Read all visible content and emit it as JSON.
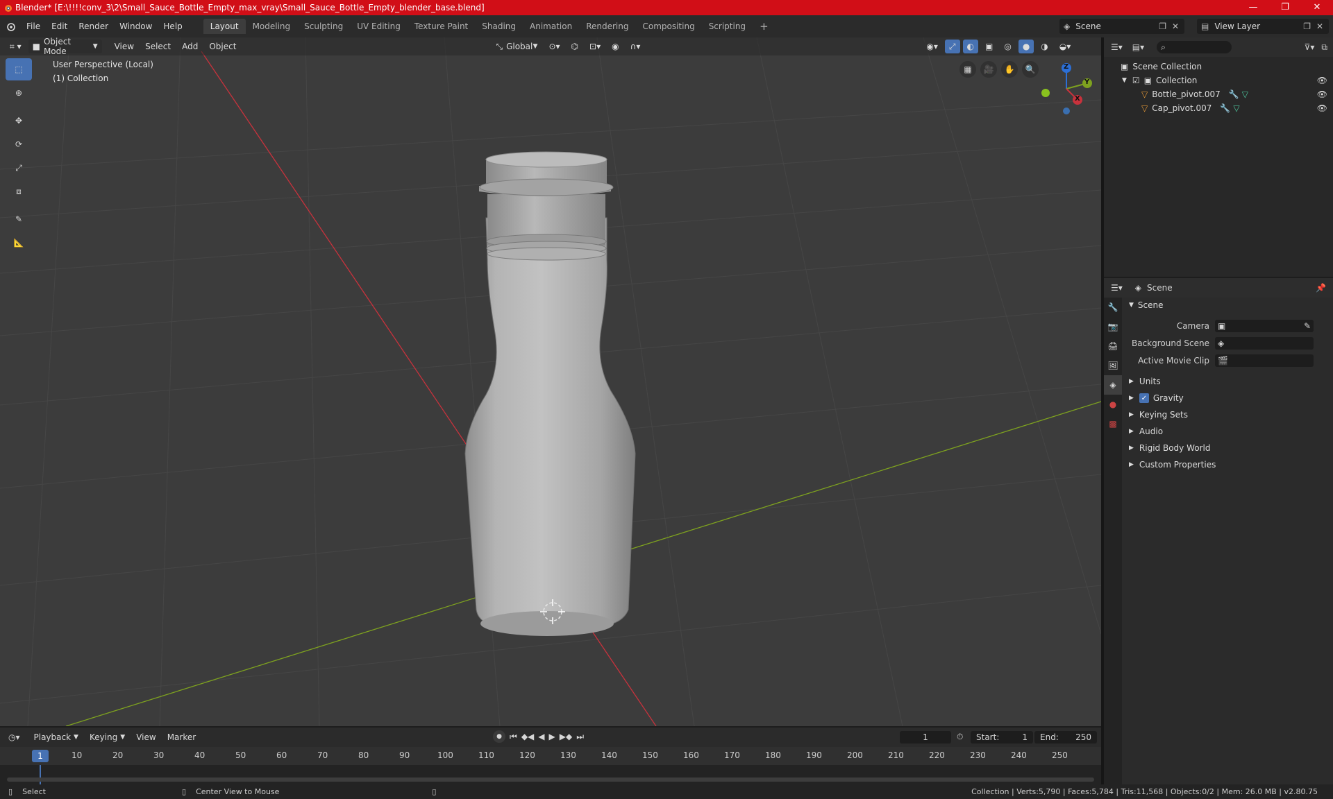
{
  "window": {
    "title": "Blender* [E:\\!!!!conv_3\\2\\Small_Sauce_Bottle_Empty_max_vray\\Small_Sauce_Bottle_Empty_blender_base.blend]",
    "minimize": "—",
    "maximize": "❐",
    "close": "✕"
  },
  "menu": [
    "File",
    "Edit",
    "Render",
    "Window",
    "Help"
  ],
  "workspaces": [
    "Layout",
    "Modeling",
    "Sculpting",
    "UV Editing",
    "Texture Paint",
    "Shading",
    "Animation",
    "Rendering",
    "Compositing",
    "Scripting"
  ],
  "active_workspace": "Layout",
  "add_workspace": "+",
  "scene": "Scene",
  "view_layer": "View Layer",
  "viewport": {
    "mode": "Object Mode",
    "menus": [
      "View",
      "Select",
      "Add",
      "Object"
    ],
    "orientation": "Global",
    "info_line1": "User Perspective (Local)",
    "info_line2": "(1) Collection",
    "gizmo": {
      "z": "Z",
      "y": "Y",
      "x": "X"
    }
  },
  "outliner": {
    "root": "Scene Collection",
    "collection": "Collection",
    "objects": [
      "Bottle_pivot.007",
      "Cap_pivot.007"
    ]
  },
  "properties": {
    "context": "Scene",
    "panel": "Scene",
    "fields": [
      {
        "label": "Camera"
      },
      {
        "label": "Background Scene"
      },
      {
        "label": "Active Movie Clip"
      }
    ],
    "collapsed_panels": [
      "Units",
      "Gravity",
      "Keying Sets",
      "Audio",
      "Rigid Body World",
      "Custom Properties"
    ]
  },
  "timeline": {
    "menus": [
      "Playback",
      "Keying",
      "View",
      "Marker"
    ],
    "current_frame": "1",
    "start_label": "Start:",
    "start": "1",
    "end_label": "End:",
    "end": "250",
    "ticks": [
      "1",
      "10",
      "20",
      "30",
      "40",
      "50",
      "60",
      "70",
      "80",
      "90",
      "100",
      "110",
      "120",
      "130",
      "140",
      "150",
      "160",
      "170",
      "180",
      "190",
      "200",
      "210",
      "220",
      "230",
      "240",
      "250"
    ]
  },
  "status": {
    "left": "Select",
    "middle": "Center View to Mouse",
    "right": "Collection | Verts:5,790 | Faces:5,784 | Tris:11,568 | Objects:0/2 | Mem: 26.0 MB | v2.80.75"
  },
  "colors": {
    "title_bar": "#d10e17",
    "accent": "#4772b3",
    "x_axis": "#c8323c",
    "y_axis": "#7ea21f",
    "z_axis": "#2c6fd6"
  }
}
